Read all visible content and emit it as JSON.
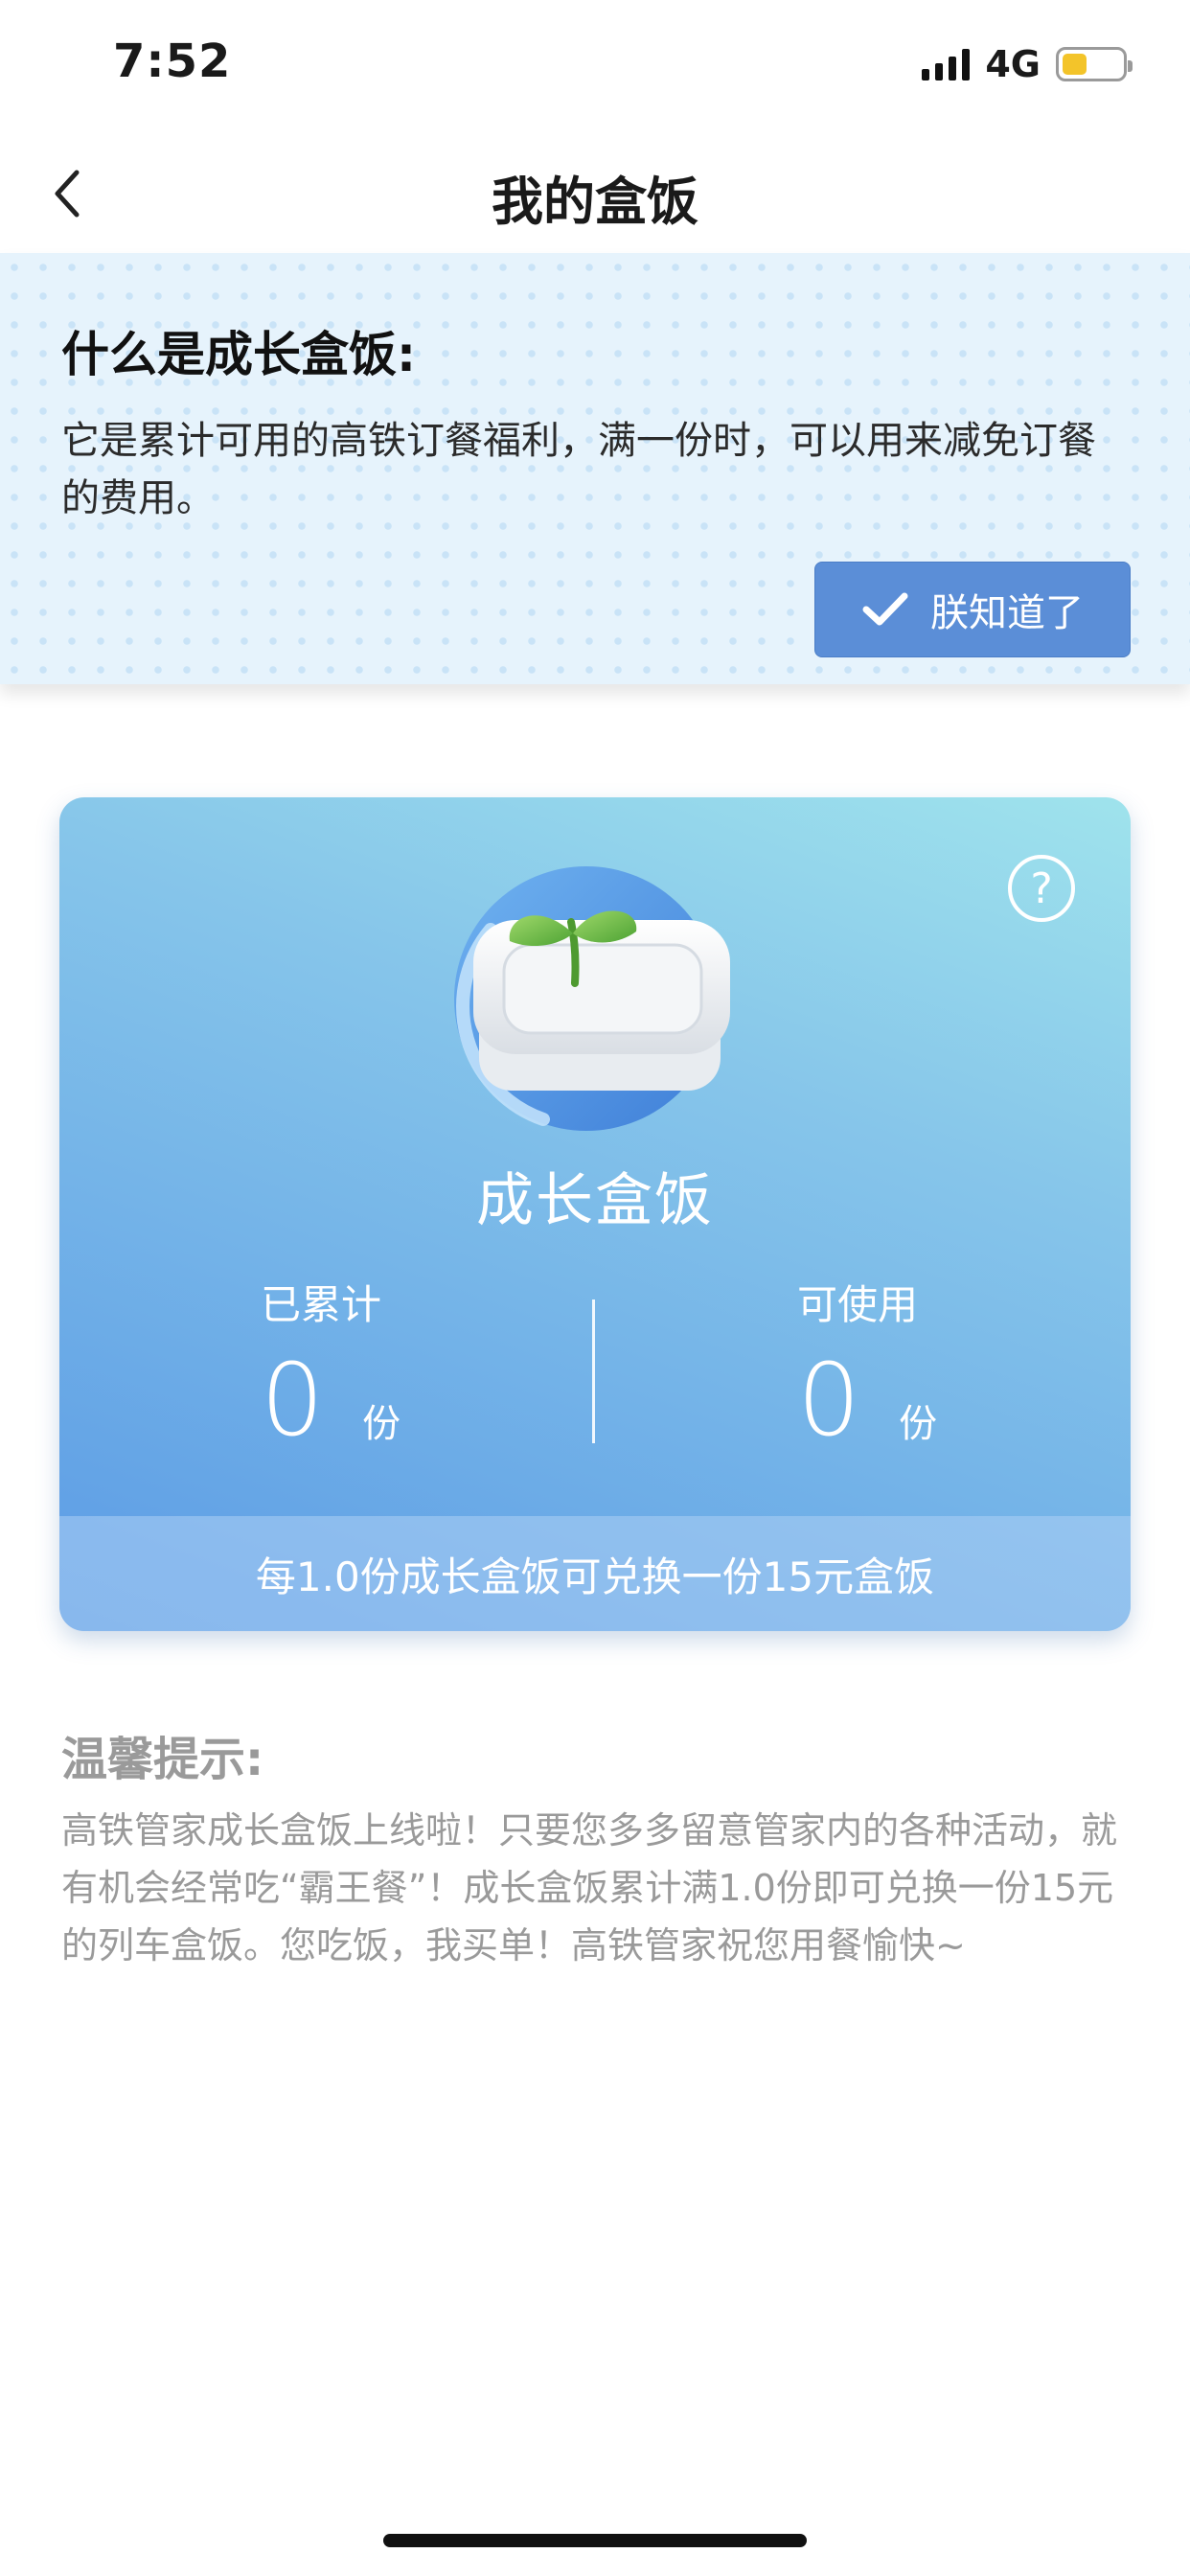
{
  "status_bar": {
    "time": "7:52",
    "network": "4G",
    "battery_level": 0.4,
    "battery_color": "#f3c42a"
  },
  "nav": {
    "back_icon": "chevron-left-icon",
    "title": "我的盒饭"
  },
  "banner": {
    "title": "什么是成长盒饭:",
    "text": "它是累计可用的高铁订餐福利，满一份时，可以用来减免订餐的费用。",
    "button_icon": "checkmark-icon",
    "button_label": "朕知道了",
    "button_color": "#5b8ed7"
  },
  "card": {
    "help_icon": "question-circle-icon",
    "illustration": "meal-box-sprout-icon",
    "title": "成长盒饭",
    "accumulated_label": "已累计",
    "accumulated_value": "0",
    "available_label": "可使用",
    "available_value": "0",
    "unit": "份",
    "footer": "每1.0份成长盒饭可兑换一份15元盒饭"
  },
  "tips": {
    "title": "温馨提示:",
    "text": "高铁管家成长盒饭上线啦！只要您多多留意管家内的各种活动，就有机会经常吃“霸王餐”！成长盒饭累计满1.0份即可兑换一份15元的列车盒饭。您吃饭，我买单！高铁管家祝您用餐愉快~"
  }
}
